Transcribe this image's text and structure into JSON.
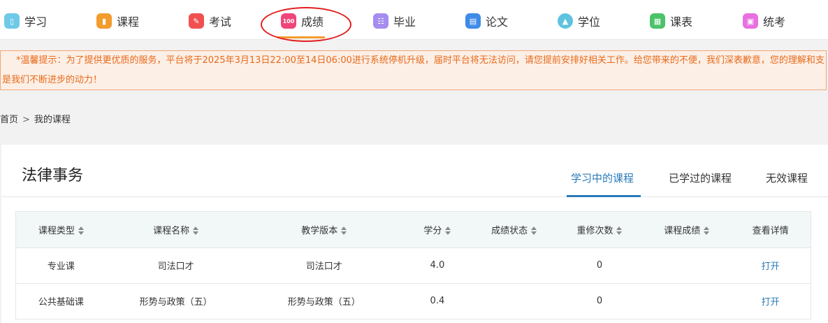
{
  "nav": {
    "items": [
      {
        "label": "学习",
        "icon": "study-icon",
        "color": "#6fc9e8"
      },
      {
        "label": "课程",
        "icon": "course-icon",
        "color": "#f39c2d"
      },
      {
        "label": "考试",
        "icon": "exam-icon",
        "color": "#f05050"
      },
      {
        "label": "成绩",
        "icon": "score-icon",
        "color": "#f0457a",
        "icon_text": "100"
      },
      {
        "label": "毕业",
        "icon": "graduation-icon",
        "color": "#a58cf0"
      },
      {
        "label": "论文",
        "icon": "thesis-icon",
        "color": "#3f8be8"
      },
      {
        "label": "学位",
        "icon": "degree-icon",
        "color": "#5fc3e0"
      },
      {
        "label": "课表",
        "icon": "schedule-icon",
        "color": "#4cc26a"
      },
      {
        "label": "统考",
        "icon": "unified-exam-icon",
        "color": "#e870e0"
      }
    ],
    "active_index": 3,
    "accent": "#f39c2d"
  },
  "notice": {
    "line1": "*温馨提示：为了提供更优质的服务，平台将于2025年3月13日22:00至14日06:00进行系统停机升级，届时平台将无法访问，请您提前安排好相关工作。给您带来的不便，我们深表歉意，您的理解和支持",
    "line2": "是我们不断进步的动力！"
  },
  "breadcrumb": {
    "home": "首页",
    "separator": ">",
    "current": "我的课程"
  },
  "card": {
    "title": "法律事务",
    "tabs": [
      "学习中的课程",
      "已学过的课程",
      "无效课程"
    ],
    "active_tab": 0
  },
  "table": {
    "headers": [
      "课程类型",
      "课程名称",
      "教学版本",
      "学分",
      "成绩状态",
      "重修次数",
      "课程成绩",
      "查看详情"
    ],
    "rows": [
      {
        "type": "专业课",
        "name": "司法口才",
        "version": "司法口才",
        "credit": "4.0",
        "status": "",
        "retakes": "0",
        "score": "",
        "detail": "打开"
      },
      {
        "type": "公共基础课",
        "name": "形势与政策（五）",
        "version": "形势与政策（五）",
        "credit": "0.4",
        "status": "",
        "retakes": "0",
        "score": "",
        "detail": "打开"
      }
    ]
  }
}
